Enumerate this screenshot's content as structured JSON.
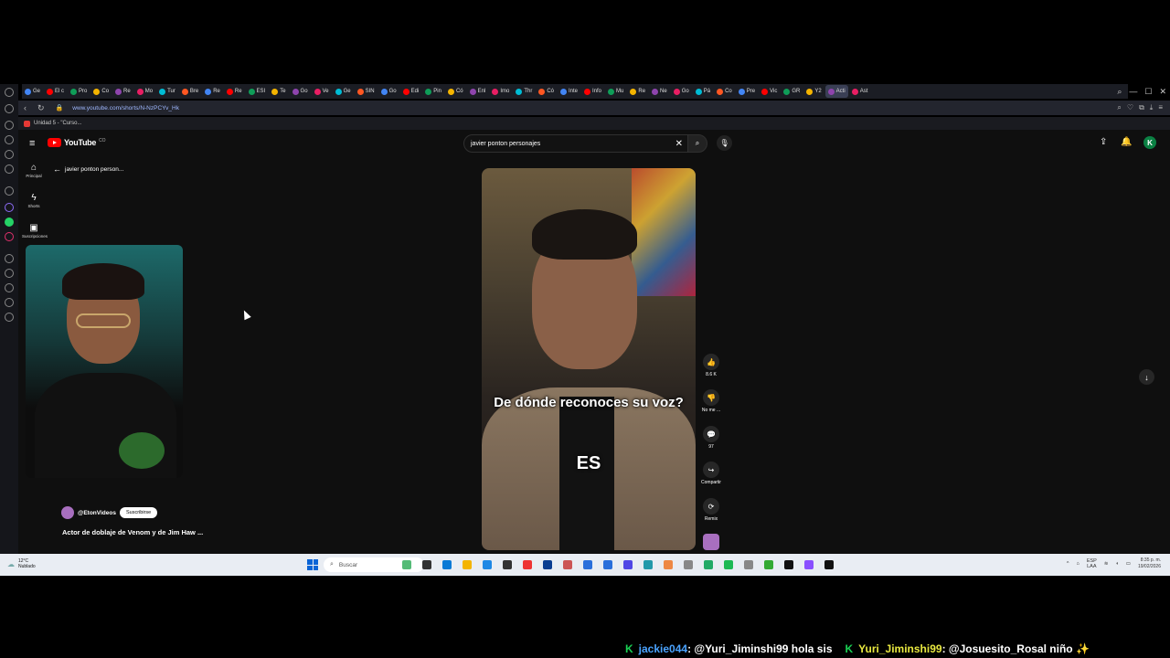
{
  "browser": {
    "tabs": [
      "Ge",
      "El c",
      "Pro",
      "Co",
      "Re",
      "Mo",
      "Tur",
      "Bre",
      "Re",
      "Re",
      "ESI",
      "Te",
      "Go",
      "Ve",
      "Ge",
      "SIN",
      "Go",
      "Edi",
      "Pin",
      "Có",
      "Enl",
      "Imo",
      "Thr",
      "Có",
      "Inte",
      "Info",
      "Mu",
      "Re",
      "Ne",
      "Go",
      "Pá",
      "Co",
      "Pre",
      "Vic",
      "GR",
      "Y2",
      "Acti",
      "Ast"
    ],
    "active_tab_index": 36,
    "url": "www.youtube.com/shorts/N-NzPCYv_Hk",
    "bookmark": "Unidad 5 - \"Curso..."
  },
  "youtube": {
    "logo_text": "YouTube",
    "logo_country": "CO",
    "search_query": "javier ponton personajes",
    "avatar_letter": "K",
    "nav": [
      {
        "label": "Principal",
        "icon": "home-icon"
      },
      {
        "label": "Shorts",
        "icon": "shorts-icon"
      },
      {
        "label": "Suscripciones",
        "icon": "subscriptions-icon"
      }
    ],
    "back_label": "javier ponton person...",
    "channel": {
      "name": "@EtonVideos",
      "subscribe_label": "Suscribirse"
    },
    "short_title": "Actor de doblaje de Venom y de Jim Haw ...",
    "caption_line1": "De dónde reconoces su voz?",
    "caption_line2": "ES",
    "actions": [
      {
        "name": "like",
        "label": "8.6 K",
        "glyph": "👍"
      },
      {
        "name": "dislike",
        "label": "No me ...",
        "glyph": "👎"
      },
      {
        "name": "comments",
        "label": "97",
        "glyph": "💬"
      },
      {
        "name": "share",
        "label": "Compartir",
        "glyph": "↪"
      },
      {
        "name": "remix",
        "label": "Remix",
        "glyph": "⟳"
      }
    ]
  },
  "taskbar": {
    "weather_temp": "12°C",
    "weather_desc": "Nublado",
    "search_placeholder": "Buscar",
    "lang": "ESP",
    "lang_sub": "LAA",
    "time": "8:35 p. m.",
    "date": "19/02/2026"
  },
  "chat": [
    {
      "user": "jackie044",
      "text": ": @Yuri_Jiminshi99 hola sis"
    },
    {
      "user": "Yuri_Jiminshi99",
      "text": ": @Josuesito_Rosal niño ✨"
    }
  ],
  "colors": {
    "youtube_red": "#ff0000",
    "mod_green": "#19d153",
    "user1": "#4aa3ff",
    "user2": "#e8e840"
  }
}
